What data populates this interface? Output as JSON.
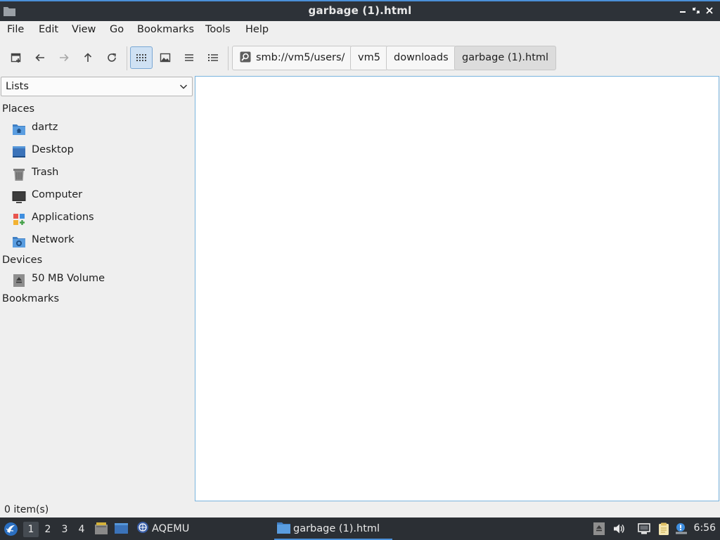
{
  "window": {
    "title": "garbage (1).html",
    "controls": [
      "minimize",
      "restore",
      "close"
    ]
  },
  "menu": {
    "file": "File",
    "edit": "Edit",
    "view": "View",
    "go": "Go",
    "bookmarks": "Bookmarks",
    "tools": "Tools",
    "help": "Help"
  },
  "toolbar": {
    "buttons": [
      "new-tab-icon",
      "back-icon",
      "forward-icon",
      "up-icon",
      "reload-icon",
      "icon-view-icon",
      "thumbnail-view-icon",
      "compact-view-icon",
      "detailed-list-icon"
    ],
    "active_view": "icon-view"
  },
  "breadcrumb": [
    {
      "label": "smb://vm5/users/",
      "icon": "smb-share-icon"
    },
    {
      "label": "vm5"
    },
    {
      "label": "downloads"
    },
    {
      "label": "garbage (1).html",
      "current": true
    }
  ],
  "sidepane": {
    "selector": "Lists",
    "sections": {
      "places": "Places",
      "devices": "Devices",
      "bookmarks": "Bookmarks"
    },
    "places": [
      {
        "label": "dartz",
        "icon": "home-folder-icon"
      },
      {
        "label": "Desktop",
        "icon": "desktop-icon"
      },
      {
        "label": "Trash",
        "icon": "trash-icon"
      },
      {
        "label": "Computer",
        "icon": "computer-icon"
      },
      {
        "label": "Applications",
        "icon": "applications-icon"
      },
      {
        "label": "Network",
        "icon": "network-icon"
      }
    ],
    "devices": [
      {
        "label": "50 MB Volume",
        "icon": "eject-icon"
      }
    ]
  },
  "status": {
    "text": "0 item(s)"
  },
  "taskbar": {
    "workspaces": [
      "1",
      "2",
      "3",
      "4"
    ],
    "active_workspace": "1",
    "apps": [
      {
        "label": "AQEMU",
        "icon": "aqemu-icon"
      },
      {
        "label": "garbage (1).html",
        "icon": "folder-icon"
      }
    ],
    "clock": "6:56"
  },
  "colors": {
    "accent": "#4a90d9",
    "titlebar": "#2d3238",
    "taskbar": "#2b2f34"
  }
}
